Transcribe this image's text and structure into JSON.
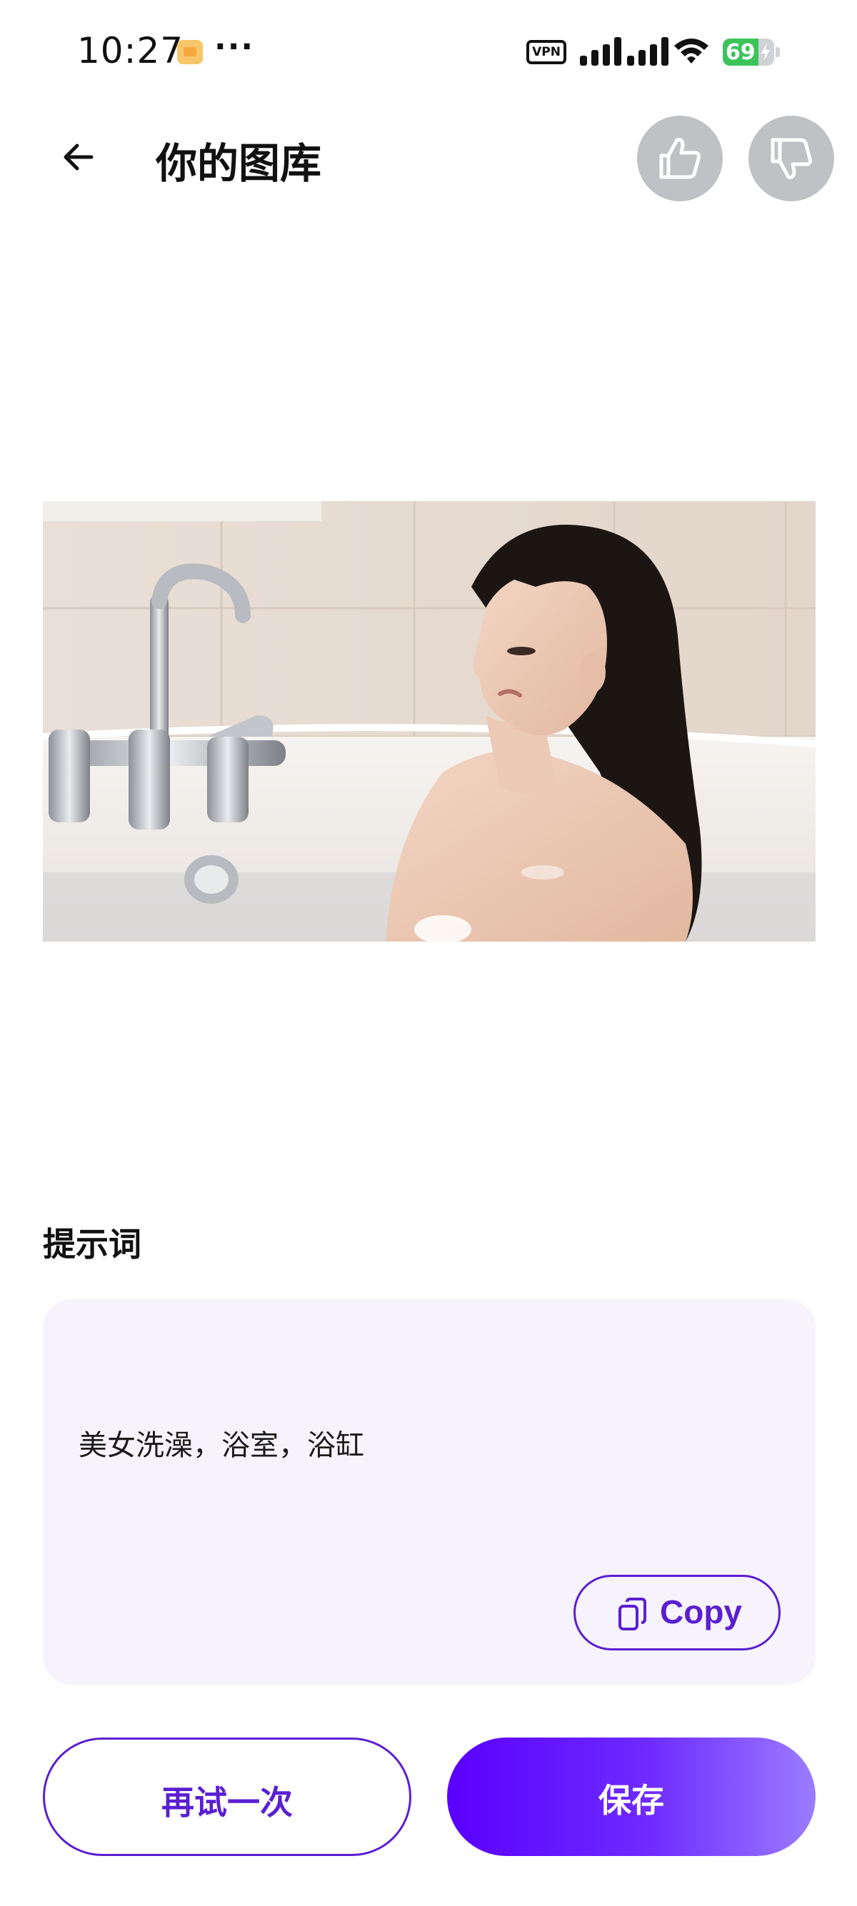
{
  "status_bar": {
    "time": "10:27",
    "more_indicator": "···",
    "vpn_label": "VPN",
    "battery_level": "69",
    "battery_fraction": 0.69,
    "icons": [
      "notification-icon",
      "vpn-icon",
      "signal-icon",
      "signal-icon",
      "wifi-icon",
      "battery-charging-icon"
    ]
  },
  "header": {
    "back_icon": "arrow-left-icon",
    "title": "你的图库",
    "like_icon": "thumbs-up-icon",
    "dislike_icon": "thumbs-down-icon"
  },
  "prompt": {
    "heading": "提示词",
    "text": "美女洗澡，浴室，浴缸",
    "copy_label": "Copy",
    "copy_icon": "copy-icon"
  },
  "actions": {
    "retry_label": "再试一次",
    "save_label": "保存"
  },
  "colors": {
    "accent": "#5a1fd1",
    "card_background": "#f7f3fd",
    "round_button": "#bfc1c4",
    "save_gradient_start": "#5a00ff",
    "save_gradient_end": "#9b7cff"
  }
}
